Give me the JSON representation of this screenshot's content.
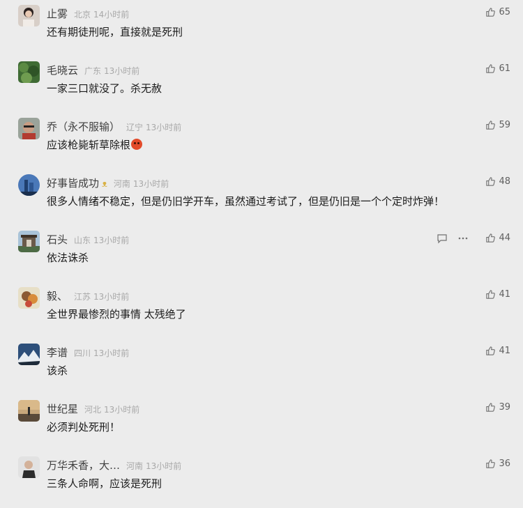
{
  "comments": [
    {
      "name": "止雾",
      "badge": "",
      "region": "北京",
      "time": "14小时前",
      "text": "还有期徒刑呢，直接就是死刑",
      "emoji": false,
      "likes": "65",
      "avatar": "portrait-woman"
    },
    {
      "name": "毛晓云",
      "badge": "",
      "region": "广东",
      "time": "13小时前",
      "text": "一家三口就没了。杀无赦",
      "emoji": false,
      "likes": "61",
      "avatar": "green-foliage"
    },
    {
      "name": "乔（永不服输）",
      "badge": "",
      "region": "辽宁",
      "time": "13小时前",
      "text": "应该枪毙斩草除根",
      "emoji": true,
      "likes": "59",
      "avatar": "man-glasses"
    },
    {
      "name": "好事皆成功",
      "badge": "ᴥ",
      "region": "河南",
      "time": "13小时前",
      "text": "很多人情绪不稳定，但是仍旧学开车，虽然通过考试了，但是仍旧是一个个定时炸弹！",
      "emoji": false,
      "likes": "48",
      "avatar": "city-tower"
    },
    {
      "name": "石头",
      "badge": "",
      "region": "山东",
      "time": "13小时前",
      "text": "依法诛杀",
      "emoji": false,
      "likes": "44",
      "avatar": "gateway",
      "show_actions": true
    },
    {
      "name": "毅、",
      "badge": "",
      "region": "江苏",
      "time": "13小时前",
      "text": "全世界最惨烈的事情  太残绝了",
      "emoji": false,
      "likes": "41",
      "avatar": "cartoon"
    },
    {
      "name": "李谱",
      "badge": "",
      "region": "四川",
      "time": "13小时前",
      "text": "该杀",
      "emoji": false,
      "likes": "41",
      "avatar": "snow-mountain"
    },
    {
      "name": "世纪星",
      "badge": "",
      "region": "河北",
      "time": "13小时前",
      "text": "必须判处死刑！",
      "emoji": false,
      "likes": "39",
      "avatar": "sunset-figure"
    },
    {
      "name": "万华禾香，大…",
      "badge": "",
      "region": "河南",
      "time": "13小时前",
      "text": "三条人命啊，应该是死刑",
      "emoji": false,
      "likes": "36",
      "avatar": "man-suit"
    }
  ],
  "icons": {
    "like": "thumbs-up-icon",
    "reply": "comment-icon",
    "more": "more-dots-icon"
  },
  "colors": {
    "background": "#ececec",
    "name": "#404040",
    "meta": "#a8a8a8",
    "text": "#1b1b1b"
  }
}
